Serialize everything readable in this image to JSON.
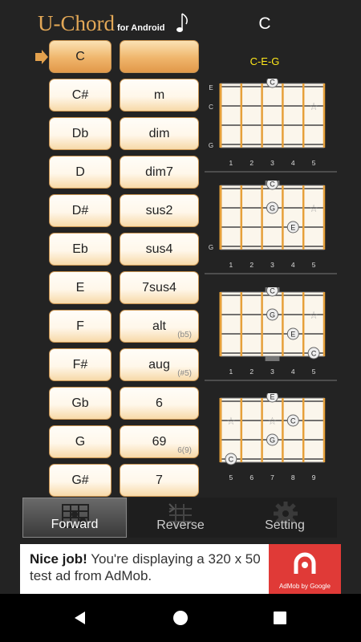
{
  "header": {
    "app_name": "U-Chord",
    "subtitle": "for Android",
    "chord": "C",
    "notes": "C-E-G"
  },
  "root_keys": [
    "C",
    "C#",
    "Db",
    "D",
    "D#",
    "Eb",
    "E",
    "F",
    "F#",
    "Gb",
    "G",
    "G#"
  ],
  "types": [
    {
      "label": "",
      "sub": ""
    },
    {
      "label": "m",
      "sub": ""
    },
    {
      "label": "dim",
      "sub": ""
    },
    {
      "label": "dim7",
      "sub": ""
    },
    {
      "label": "sus2",
      "sub": ""
    },
    {
      "label": "sus4",
      "sub": ""
    },
    {
      "label": "7sus4",
      "sub": ""
    },
    {
      "label": "alt",
      "sub": "(b5)"
    },
    {
      "label": "aug",
      "sub": "(#5)"
    },
    {
      "label": "6",
      "sub": ""
    },
    {
      "label": "69",
      "sub": "6(9)"
    },
    {
      "label": "7",
      "sub": ""
    }
  ],
  "fretboards": [
    {
      "strings": [
        "E",
        "C",
        "G"
      ],
      "fret_numbers": [
        "1",
        "2",
        "3",
        "4",
        "5"
      ],
      "dots": [
        {
          "s": 0,
          "f": 3,
          "n": "C"
        }
      ],
      "stars": [
        {
          "s": 1,
          "f": 5
        }
      ]
    },
    {
      "strings": [
        "",
        "",
        "G"
      ],
      "fret_numbers": [
        "1",
        "2",
        "3",
        "4",
        "5"
      ],
      "dots": [
        {
          "s": 0,
          "f": 3,
          "n": "C"
        },
        {
          "s": 1,
          "f": 3,
          "n": "G"
        },
        {
          "s": 2,
          "f": 4,
          "n": "E"
        }
      ],
      "stars": [
        {
          "s": 1,
          "f": 5
        }
      ]
    },
    {
      "strings": [
        "",
        "",
        ""
      ],
      "fret_numbers": [
        "1",
        "2",
        "3",
        "4",
        "5"
      ],
      "dots": [
        {
          "s": 0,
          "f": 3,
          "n": "C"
        },
        {
          "s": 1,
          "f": 3,
          "n": "G"
        },
        {
          "s": 2,
          "f": 4,
          "n": "E"
        },
        {
          "s": 3,
          "f": 5,
          "n": "C"
        }
      ],
      "stars": [
        {
          "s": 1,
          "f": 5
        }
      ]
    },
    {
      "strings": [
        "",
        "",
        ""
      ],
      "fret_numbers": [
        "5",
        "6",
        "7",
        "8",
        "9"
      ],
      "dots": [
        {
          "s": 0,
          "f": 3,
          "n": "E"
        },
        {
          "s": 1,
          "f": 4,
          "n": "C"
        },
        {
          "s": 2,
          "f": 3,
          "n": "G"
        },
        {
          "s": 3,
          "f": 1,
          "n": "C"
        }
      ],
      "stars": [
        {
          "s": 1,
          "f": 1
        },
        {
          "s": 1,
          "f": 3
        }
      ]
    }
  ],
  "tabs": [
    "Forward",
    "Reverse",
    "Setting"
  ],
  "ad": {
    "headline": "Nice job!",
    "body": " You're displaying a 320 x 50 test ad from AdMob.",
    "brand": "AdMob by Google"
  }
}
